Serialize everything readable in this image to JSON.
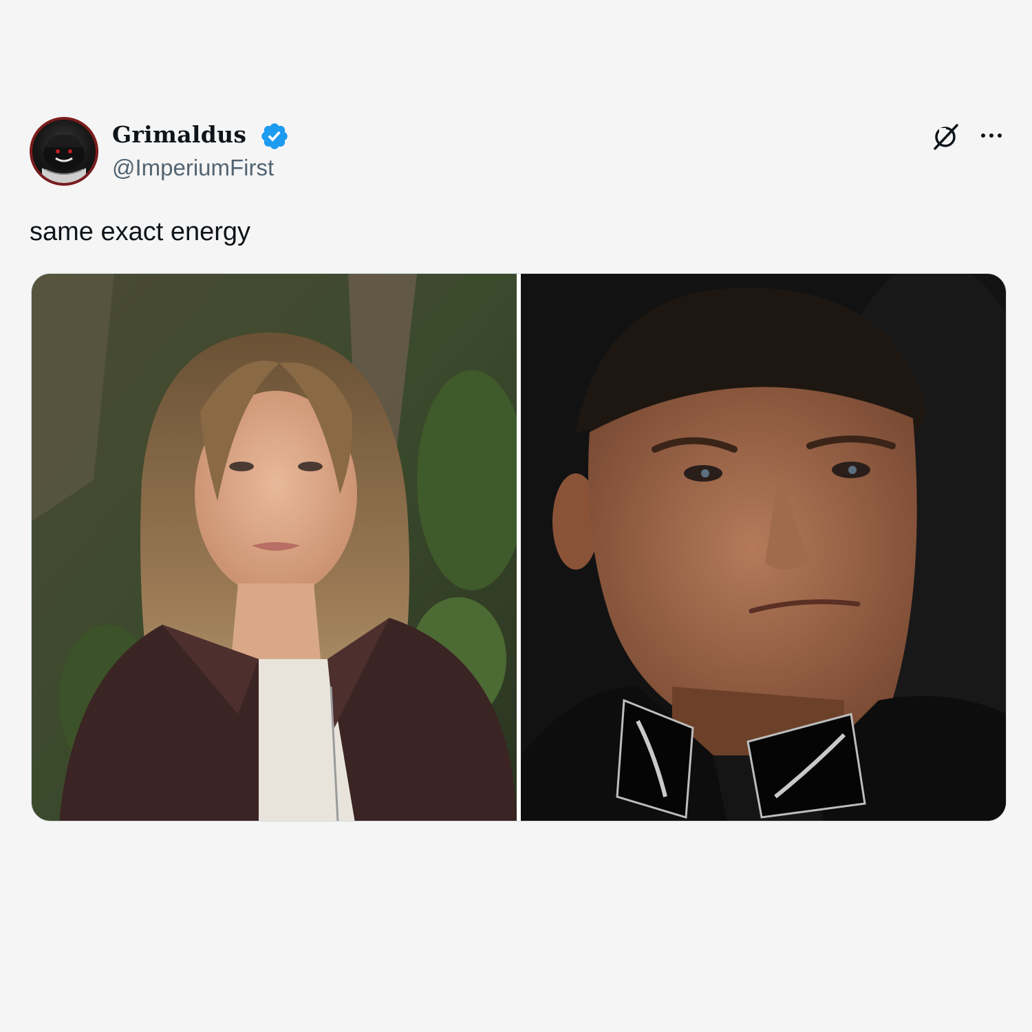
{
  "tweet": {
    "author": {
      "display_name": "Grimaldus",
      "handle": "@ImperiumFirst",
      "verified": true,
      "avatar_icon": "avatar-dark-creature"
    },
    "text": "same exact energy",
    "actions": {
      "grok_icon": "grok-slash-icon",
      "more_icon": "more-horizontal-icon"
    },
    "media": [
      {
        "kind": "photo",
        "description_icon": "photo-woman-leather-jacket"
      },
      {
        "kind": "photo",
        "description_icon": "photo-man-uniform"
      }
    ]
  },
  "colors": {
    "background": "#f5f5f5",
    "verified_blue": "#1d9bf0",
    "handle_gray": "#536471",
    "avatar_ring": "#7a1d1d"
  }
}
